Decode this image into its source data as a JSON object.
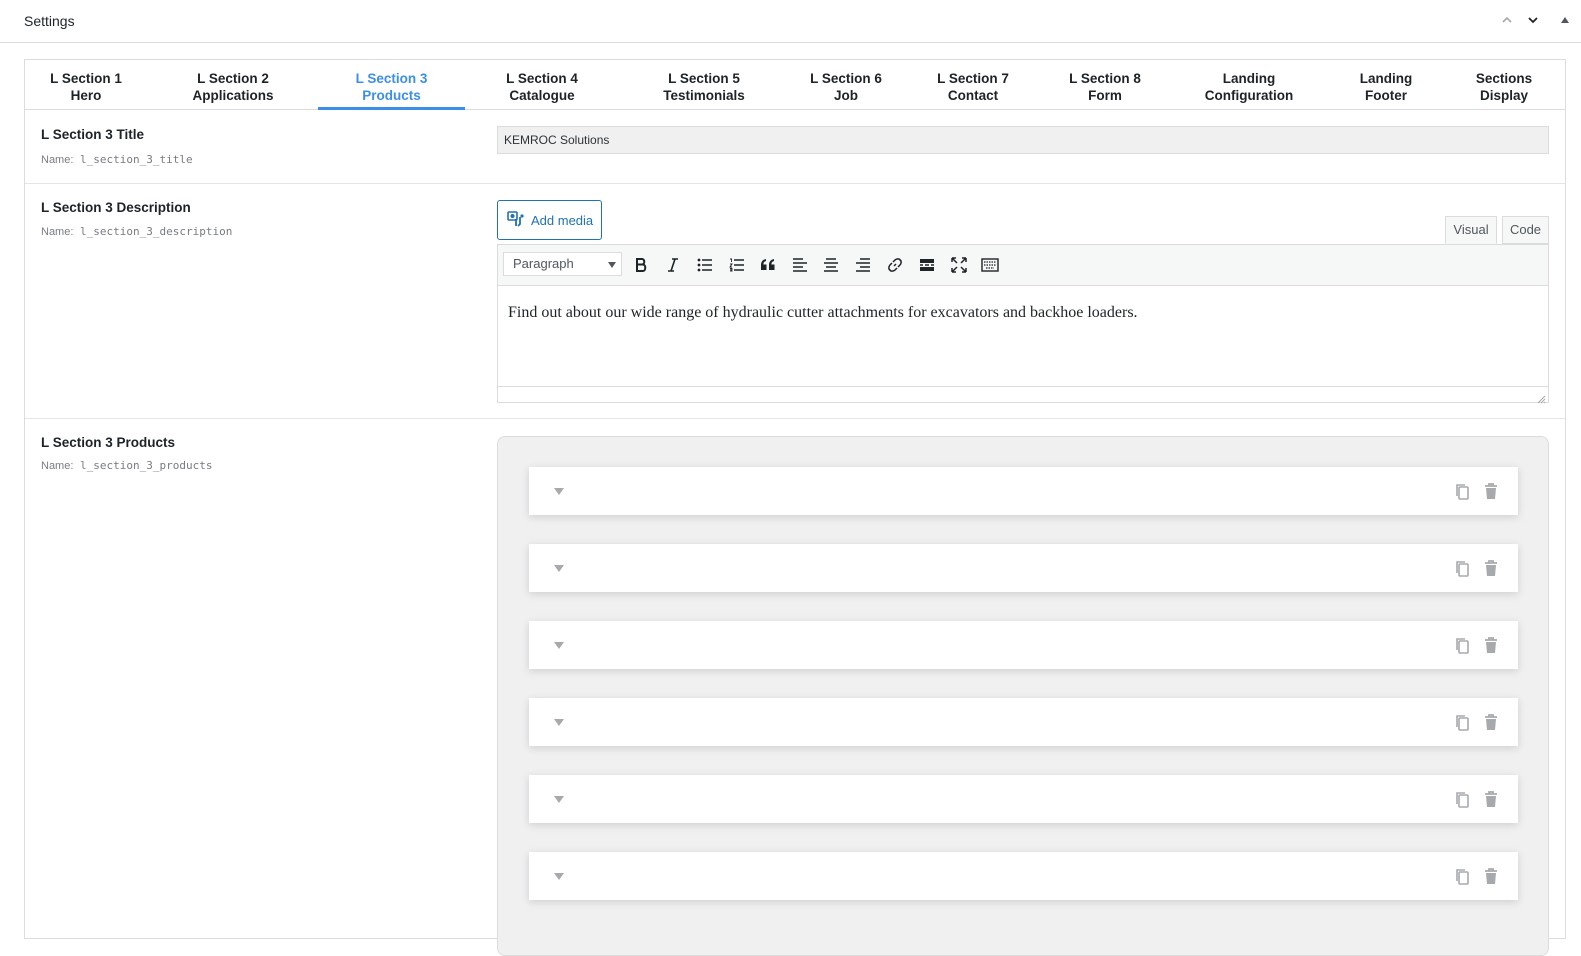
{
  "header": {
    "title": "Settings",
    "icons": [
      "chevron-up-icon",
      "chevron-down-icon",
      "triangle-up-icon"
    ]
  },
  "tabs": [
    {
      "line1": "L Section 1",
      "line2": "Hero",
      "active": false
    },
    {
      "line1": "L Section 2",
      "line2": "Applications",
      "active": false
    },
    {
      "line1": "L Section 3",
      "line2": "Products",
      "active": true
    },
    {
      "line1": "L Section 4",
      "line2": "Catalogue",
      "active": false
    },
    {
      "line1": "L Section 5",
      "line2": "Testimonials",
      "active": false
    },
    {
      "line1": "L Section 6",
      "line2": "Job",
      "active": false
    },
    {
      "line1": "L Section 7",
      "line2": "Contact",
      "active": false
    },
    {
      "line1": "L Section 8",
      "line2": "Form",
      "active": false
    },
    {
      "line1": "Landing",
      "line2": "Configuration",
      "active": false
    },
    {
      "line1": "Landing",
      "line2": "Footer",
      "active": false
    },
    {
      "line1": "Sections",
      "line2": "Display",
      "active": false
    }
  ],
  "fields": {
    "title": {
      "label": "L Section 3 Title",
      "name_prefix": "Name:",
      "name": "l_section_3_title",
      "value": "KEMROC Solutions"
    },
    "description": {
      "label": "L Section 3 Description",
      "name_prefix": "Name:",
      "name": "l_section_3_description",
      "add_media": "Add media",
      "mode_visual": "Visual",
      "mode_code": "Code",
      "format": "Paragraph",
      "content": "Find out about our wide range of hydraulic cutter attachments for excavators and backhoe loaders."
    },
    "products": {
      "label": "L Section 3 Products",
      "name_prefix": "Name:",
      "name": "l_section_3_products",
      "item_count": 6
    }
  },
  "colors": {
    "accent": "#3c8fe8",
    "button": "#2271b1"
  }
}
